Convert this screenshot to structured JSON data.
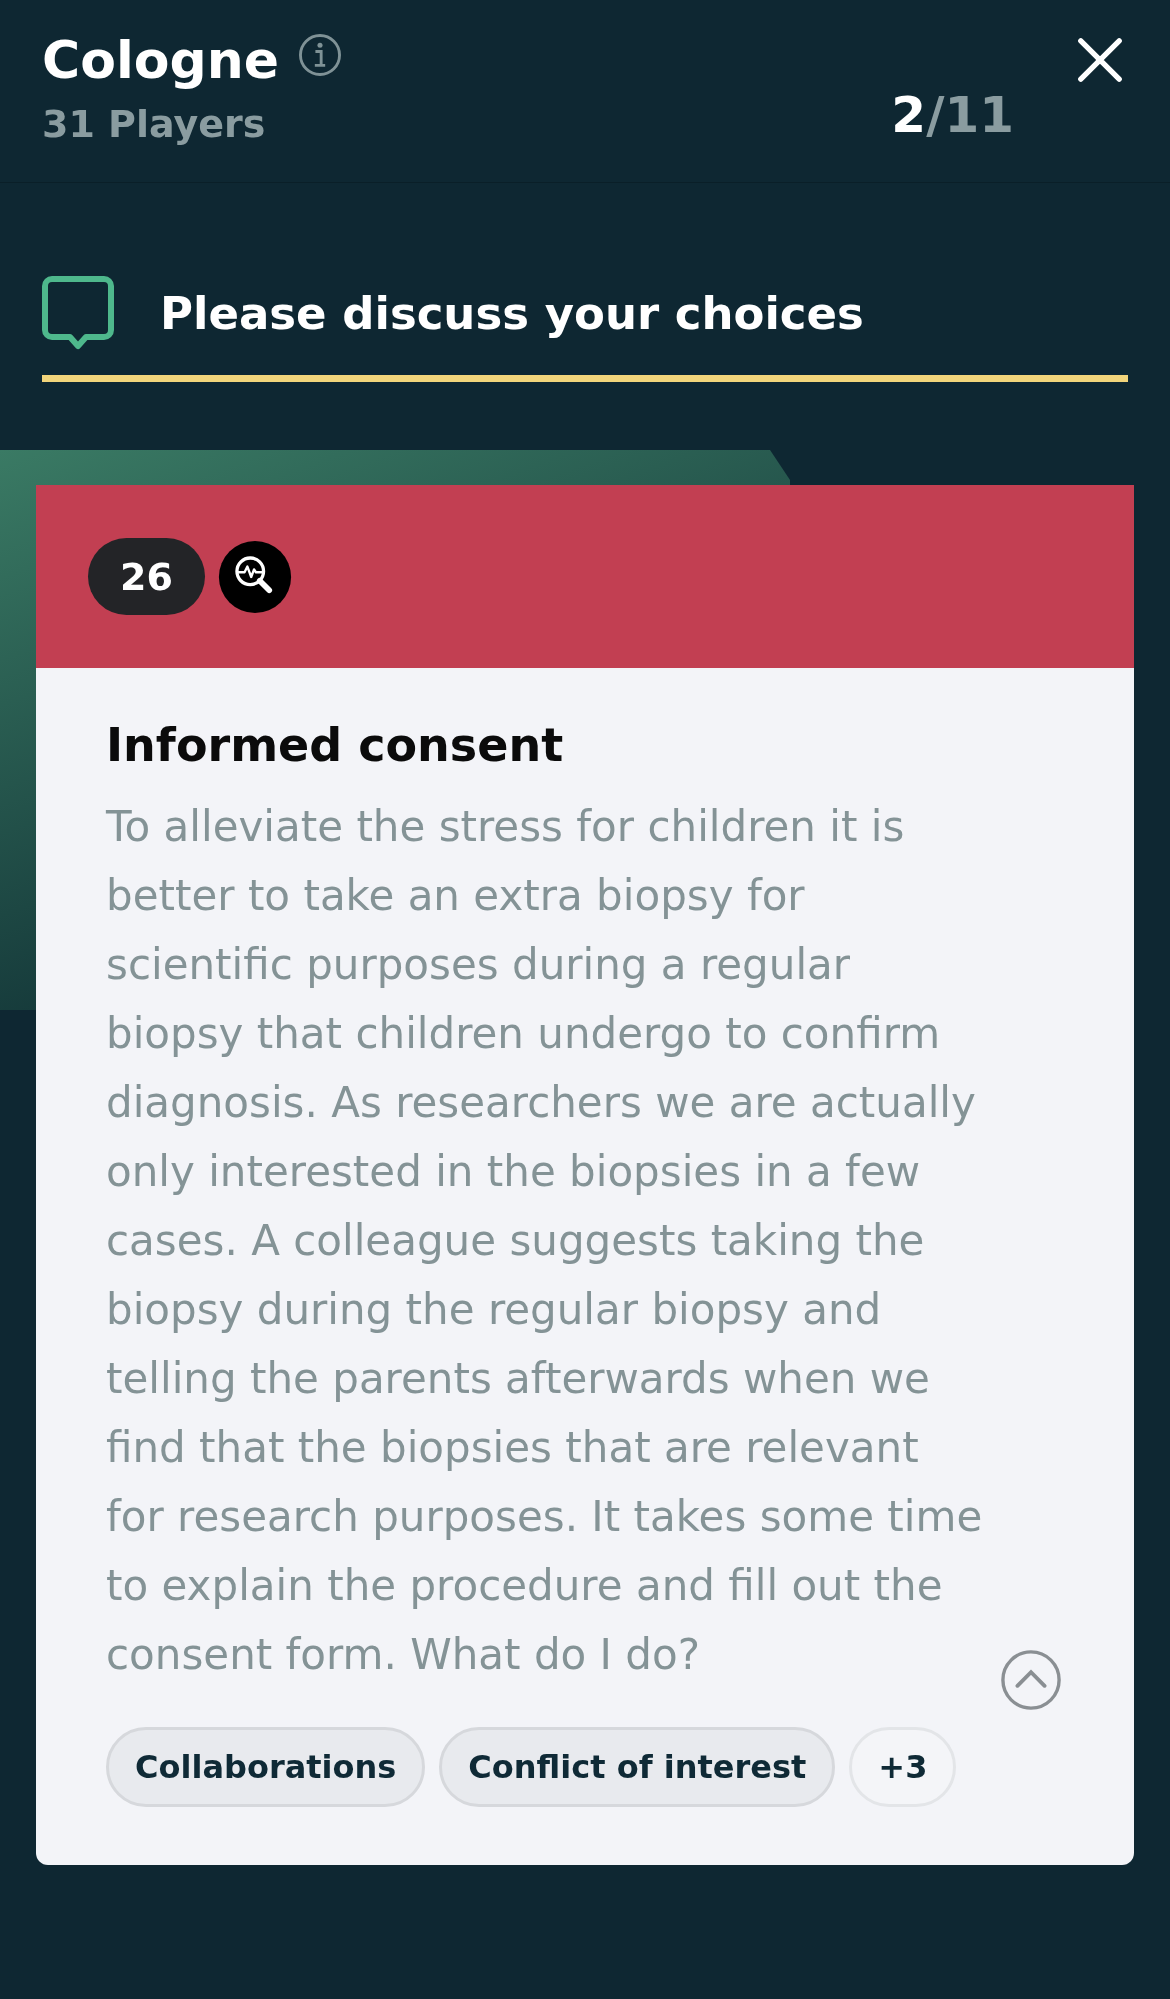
{
  "header": {
    "title": "Cologne",
    "subtitle": "31 Players",
    "progress": {
      "current": "2",
      "total": "/11"
    }
  },
  "prompt": {
    "text": "Please discuss your choices"
  },
  "card": {
    "number": "26",
    "title": "Informed consent",
    "body": "To alleviate the stress for children it is better to take an extra biopsy for scientific purposes during a regular biopsy that children undergo to confirm diagnosis. As researchers we are actually only interested in the biopsies in a few cases. A colleague suggests taking the biopsy during the regular biopsy and telling the parents afterwards when we find that the biopsies that are relevant for research purposes. It takes some time to explain the procedure and fill out the consent form. What do I do?",
    "tags": [
      {
        "label": "Collaborations",
        "kind": "tag"
      },
      {
        "label": "Conflict of interest",
        "kind": "tag"
      },
      {
        "label": "+3",
        "kind": "more"
      }
    ]
  }
}
